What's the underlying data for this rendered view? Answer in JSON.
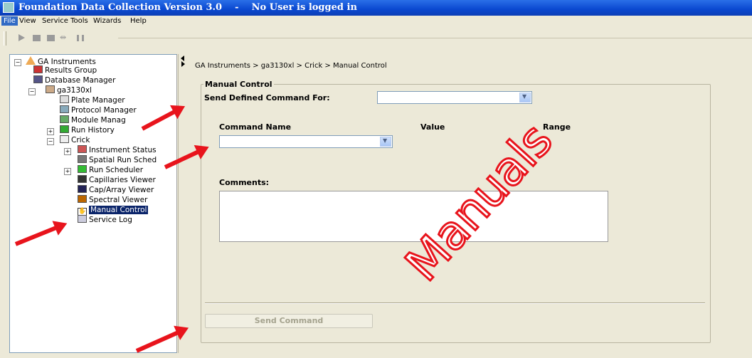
{
  "window": {
    "title": "Foundation Data Collection Version 3.0    -    No User is logged in"
  },
  "menu": [
    "File",
    "View",
    "Service Tools",
    "Wizards",
    "Help"
  ],
  "tree": {
    "items": [
      {
        "label": "GA Instruments",
        "icon": "ga-instruments-icon",
        "expander": "−"
      },
      {
        "label": "Results Group",
        "icon": "results-group-icon"
      },
      {
        "label": "Database Manager",
        "icon": "database-icon"
      },
      {
        "label": "ga3130xl",
        "icon": "instrument-icon",
        "expander": "−"
      },
      {
        "label": "Plate Manager",
        "icon": "plate-icon"
      },
      {
        "label": "Protocol Manager",
        "icon": "protocol-icon"
      },
      {
        "label": "Module Manag",
        "icon": "module-icon"
      },
      {
        "label": "Run History",
        "icon": "run-history-icon",
        "expander": "+"
      },
      {
        "label": "Crick",
        "icon": "crick-icon",
        "expander": "−"
      },
      {
        "label": "Instrument Status",
        "icon": "instrument-status-icon",
        "expander": "+"
      },
      {
        "label": "Spatial Run Sched",
        "icon": "spatial-run-icon"
      },
      {
        "label": "Run Scheduler",
        "icon": "run-scheduler-icon",
        "expander": "+"
      },
      {
        "label": "Capillaries Viewer",
        "icon": "capillaries-icon"
      },
      {
        "label": "Cap/Array Viewer",
        "icon": "cap-array-icon"
      },
      {
        "label": "Spectral Viewer",
        "icon": "spectral-icon"
      },
      {
        "label": "Manual Control",
        "icon": "hand-icon",
        "selected": true
      },
      {
        "label": "Service Log",
        "icon": "service-log-icon"
      }
    ]
  },
  "content": {
    "breadcrumb": "GA Instruments > ga3130xl > Crick > Manual Control",
    "group_title": "Manual Control",
    "send_for_label": "Send Defined Command For:",
    "send_for_value": "",
    "command_name_label": "Command Name",
    "value_label": "Value",
    "range_label": "Range",
    "command_value": "",
    "comments_label": "Comments:",
    "comments_value": "",
    "send_button": "Send Command"
  },
  "watermark": "Manuals",
  "colors": {
    "accent": "#e8141c",
    "selection": "#0a246a",
    "titlebar": "#0a48d0"
  }
}
